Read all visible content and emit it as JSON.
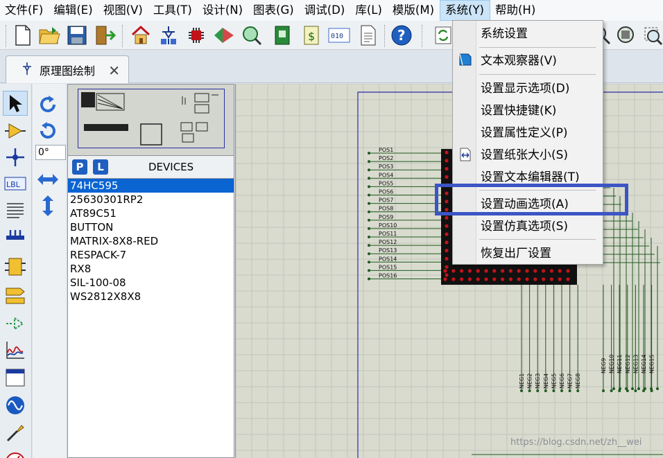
{
  "menubar": {
    "items": [
      "文件(F)",
      "编辑(E)",
      "视图(V)",
      "工具(T)",
      "设计(N)",
      "图表(G)",
      "调试(D)",
      "库(L)",
      "模版(M)",
      "系统(Y)",
      "帮助(H)"
    ],
    "open_item": "系统(Y)"
  },
  "tab": {
    "label": "原理图绘制",
    "close": "✕"
  },
  "rotation": {
    "angle": "0°"
  },
  "devices": {
    "buttons": [
      "P",
      "L"
    ],
    "title": "DEVICES",
    "items": [
      "74HC595",
      "25630301RP2",
      "AT89C51",
      "BUTTON",
      "MATRIX-8X8-RED",
      "RESPACK-7",
      "RX8",
      "SIL-100-08",
      "WS2812X8X8"
    ],
    "selected_index": 0
  },
  "system_menu": {
    "items": [
      "系统设置",
      "文本观察器(V)",
      "设置显示选项(D)",
      "设置快捷键(K)",
      "设置属性定义(P)",
      "设置纸张大小(S)",
      "设置文本编辑器(T)",
      "设置动画选项(A)",
      "设置仿真选项(S)",
      "恢复出厂设置"
    ],
    "highlighted": "设置动画选项(A)"
  },
  "schematic": {
    "pos_labels": [
      "POS1",
      "POS2",
      "POS3",
      "POS4",
      "POS5",
      "POS6",
      "POS7",
      "POS8",
      "POS9",
      "POS10",
      "POS11",
      "POS12",
      "POS13",
      "POS14",
      "POS15",
      "POS16"
    ],
    "neg_labels": [
      "NEG1",
      "NEG2",
      "NEG3",
      "NEG4",
      "NEG5",
      "NEG6",
      "NEG7",
      "NEG8",
      "NEG9",
      "NEG10",
      "NEG11",
      "NEG12",
      "NEG13",
      "NEG14",
      "NEG15"
    ]
  },
  "watermark": "https://blog.csdn.net/zh__wei",
  "colors": {
    "accent": "#0a64d2",
    "highlight_box": "#3c55c4",
    "led_red": "#c0141a",
    "wire": "#1f5a1f"
  }
}
